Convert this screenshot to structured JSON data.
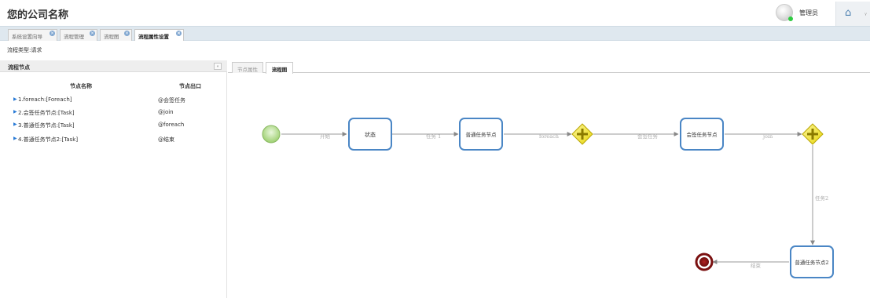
{
  "header": {
    "company": "您的公司名称",
    "username": "管理员",
    "overflow_mark": "ᵧ"
  },
  "page_tabs": [
    {
      "label": "系统设置向导",
      "active": false
    },
    {
      "label": "流程管理",
      "active": false
    },
    {
      "label": "流程图",
      "active": false
    },
    {
      "label": "流程属性设置",
      "active": true
    }
  ],
  "process_type": "流程类型:请求",
  "left_panel": {
    "title": "流程节点",
    "col_name": "节点名称",
    "col_out": "节点出口",
    "nodes": [
      {
        "name": "1.foreach:[Foreach]",
        "out": "@会签任务"
      },
      {
        "name": "2.会签任务节点:[Task]",
        "out": "@join"
      },
      {
        "name": "3.普通任务节点:[Task]",
        "out": "@foreach"
      },
      {
        "name": "4.普通任务节点2:[Task]",
        "out": "@结束"
      }
    ]
  },
  "right_tabs": [
    {
      "label": "节点属性",
      "active": false
    },
    {
      "label": "流程图",
      "active": true
    }
  ],
  "flow": {
    "nodes": {
      "n1": "状态",
      "n2": "普通任务节点",
      "n3": "会签任务节点",
      "n4": "普通任务节点2"
    },
    "edges": {
      "e_start": "开始",
      "e_task1": "任务 1",
      "e_foreach": "foreach",
      "e_sign": "会签任务",
      "e_join": "join",
      "e_task2": "任务2",
      "e_end": "结束"
    }
  },
  "colors": {
    "accent": "#4a86c5",
    "tab_strip": "#dfe8ef",
    "gateway": "#f2e61e",
    "end_event": "#8b1a1a",
    "start_event": "#b6df8d"
  }
}
